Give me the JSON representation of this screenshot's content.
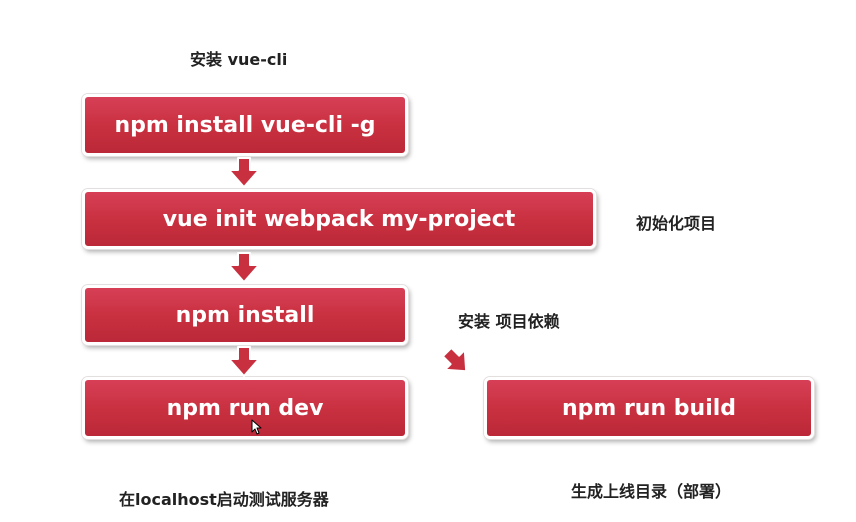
{
  "diagram": {
    "nodes": [
      {
        "id": "install-vue-cli",
        "text": "npm install vue-cli -g"
      },
      {
        "id": "init-project",
        "text": "vue init webpack my-project"
      },
      {
        "id": "install-deps",
        "text": "npm install"
      },
      {
        "id": "run-dev",
        "text": "npm run dev"
      },
      {
        "id": "run-build",
        "text": "npm run build"
      }
    ],
    "labels": {
      "install_vue_cli": "安装 vue-cli",
      "init_project": "初始化项目",
      "install_deps": "安装 项目依赖",
      "run_dev": "在localhost启动测试服务器",
      "run_build": "生成上线目录（部署）"
    },
    "colors": {
      "node_fill": "#c8303f",
      "node_text": "#ffffff",
      "label_text": "#222222"
    }
  }
}
